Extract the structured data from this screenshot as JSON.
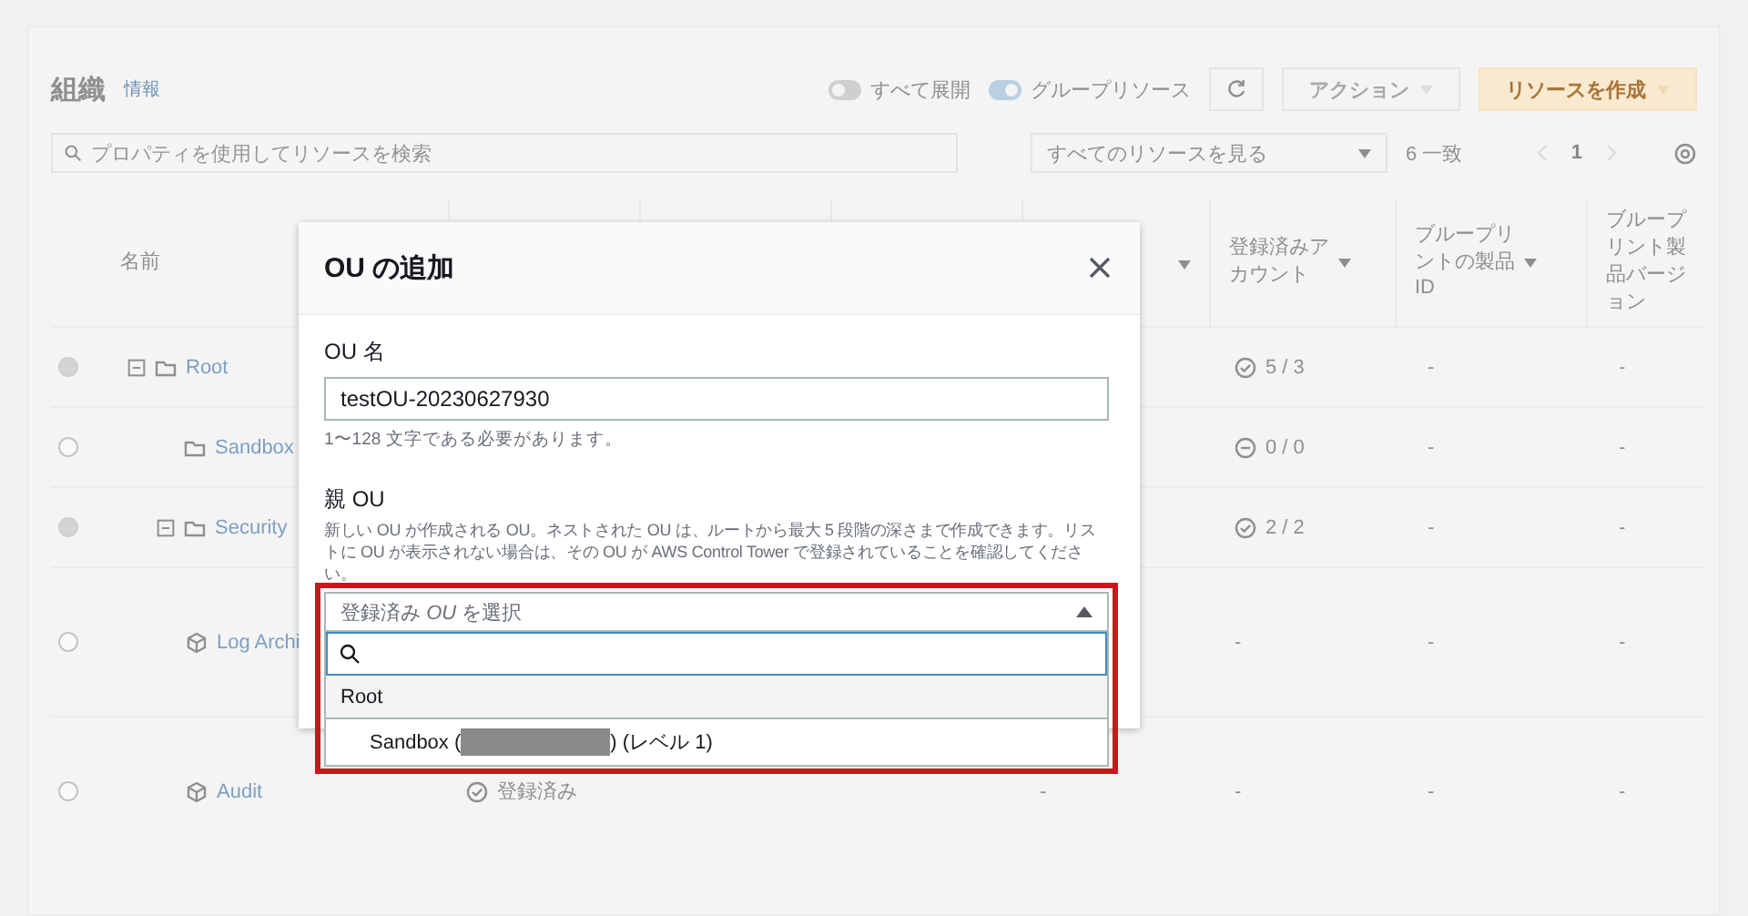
{
  "page": {
    "title": "組織",
    "info_link": "情報",
    "toggles": [
      {
        "label": "すべて展開",
        "on": false
      },
      {
        "label": "グループリソース",
        "on": true
      }
    ],
    "actions_button": {
      "label": "アクション",
      "disabled": true
    },
    "create_button": {
      "label": "リソースを作成"
    },
    "search": {
      "placeholder": "プロパティを使用してリソースを検索"
    },
    "filter_select": {
      "value": "すべてのリソースを見る"
    },
    "match_count": "6 一致",
    "pagination": {
      "pages": [
        {
          "label": "1",
          "selected": true
        }
      ]
    }
  },
  "table": {
    "columns": [
      {
        "kind": "name",
        "label": "名前"
      },
      {
        "kind": "accounts",
        "label": "登録済みアカウント"
      },
      {
        "kind": "bp_id",
        "label": "ブループリントの製品 ID"
      },
      {
        "kind": "bp_version",
        "label": "ブループリント製品バージョン"
      }
    ],
    "rows": [
      {
        "kind": "ou",
        "name": "Root",
        "disabled": true,
        "expanded": true,
        "accounts": {
          "text": "5 / 3",
          "complete": true
        },
        "bp_id": "-",
        "bp_version": "-",
        "children": [
          {
            "kind": "ou",
            "name": "Sandbox",
            "disabled": false,
            "accounts": {
              "text": "0 / 0",
              "complete": false
            },
            "bp_id": "-",
            "bp_version": "-"
          },
          {
            "kind": "ou",
            "name": "Security",
            "disabled": true,
            "expanded": true,
            "accounts": {
              "text": "2 / 2",
              "complete": true
            },
            "bp_id": "-",
            "bp_version": "-",
            "children": [
              {
                "kind": "account",
                "name": "Log Archi",
                "disabled": false,
                "accounts": {
                  "text": "-"
                },
                "bp_id": "-",
                "bp_version": "-"
              },
              {
                "kind": "account",
                "name": "Audit",
                "disabled": false,
                "status": "登録済み",
                "column_5": "-",
                "accounts": {
                  "text": "-"
                },
                "bp_id": "-",
                "bp_version": "-"
              }
            ]
          }
        ]
      }
    ]
  },
  "dialog": {
    "title": "OU の追加",
    "name_field": {
      "label": "OU 名",
      "value": "testOU-20230627930",
      "hint": "1〜128 文字である必要があります。"
    },
    "parent_field": {
      "label": "親 OU",
      "description": "新しい OU が作成される OU。ネストされた OU は、ルートから最大 5 段階の深さまで作成できます。リストに OU が表示されない場合は、その OU が AWS Control Tower で登録されていることを確認してください。",
      "placeholder": "登録済み *OU* を選択",
      "expanded": true,
      "options": [
        {
          "kind": "group",
          "label": "Root"
        },
        {
          "kind": "option",
          "label_start": "Sandbox (",
          "redacted": true,
          "label_end": ") (レベル 1)",
          "selected": false
        }
      ]
    }
  }
}
